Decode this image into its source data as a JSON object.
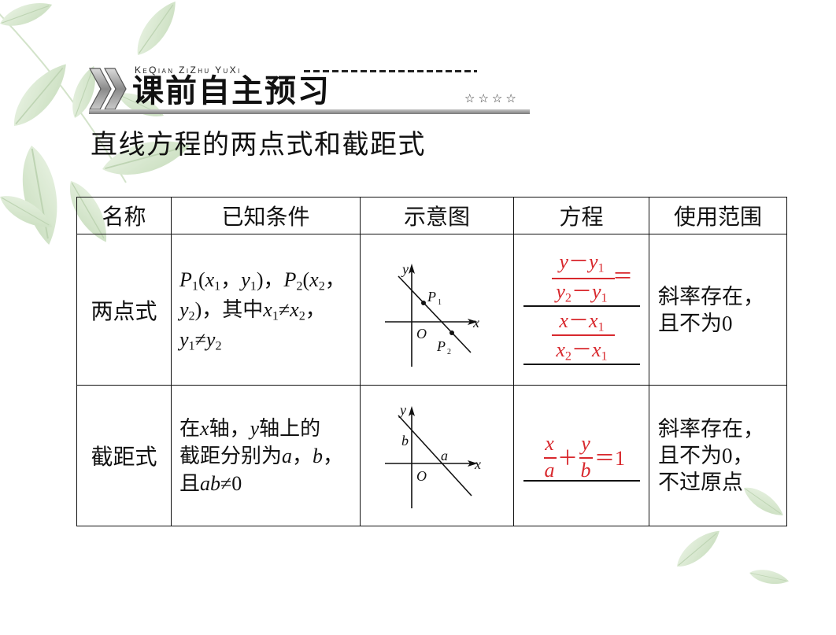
{
  "colors": {
    "answer_red": "#d8282d"
  },
  "header": {
    "pinyin": "KeQian ZiZhu YuXi",
    "title": "课前自主预习",
    "stars": "☆☆☆☆"
  },
  "subtitle": "直线方程的两点式和截距式",
  "table": {
    "headers": [
      "名称",
      "已知条件",
      "示意图",
      "方程",
      "使用范围"
    ],
    "rows": [
      {
        "name": "两点式",
        "conditions": [
          [
            {
              "i": "P"
            },
            {
              "sub": "1"
            },
            {
              "t": "("
            },
            {
              "i": "x"
            },
            {
              "sub": "1"
            },
            {
              "t": "，"
            },
            {
              "i": "y"
            },
            {
              "sub": "1"
            },
            {
              "t": ")，"
            },
            {
              "i": "P"
            },
            {
              "sub": "2"
            },
            {
              "t": "("
            },
            {
              "i": "x"
            },
            {
              "sub": "2"
            },
            {
              "t": "，"
            }
          ],
          [
            {
              "i": "y"
            },
            {
              "sub": "2"
            },
            {
              "t": ")，其中"
            },
            {
              "i": "x"
            },
            {
              "sub": "1"
            },
            {
              "t": "≠"
            },
            {
              "i": "x"
            },
            {
              "sub": "2"
            },
            {
              "t": "，"
            }
          ],
          [
            {
              "i": "y"
            },
            {
              "sub": "1"
            },
            {
              "t": "≠"
            },
            {
              "i": "y"
            },
            {
              "sub": "2"
            }
          ]
        ],
        "diagram": {
          "y_label": "y",
          "x_label": "x",
          "origin": "O",
          "p1": "P",
          "p1_sub": "1",
          "p2": "P",
          "p2_sub": "2"
        },
        "equation": {
          "left_num": [
            {
              "i": "y"
            },
            {
              "t": "－"
            },
            {
              "i": "y"
            },
            {
              "sub": "1"
            }
          ],
          "left_den": [
            {
              "i": "y"
            },
            {
              "sub": "2"
            },
            {
              "t": "－"
            },
            {
              "i": "y"
            },
            {
              "sub": "1"
            }
          ],
          "equals": "＝",
          "right_num": [
            {
              "i": "x"
            },
            {
              "t": "－"
            },
            {
              "i": "x"
            },
            {
              "sub": "1"
            }
          ],
          "right_den": [
            {
              "i": "x"
            },
            {
              "sub": "2"
            },
            {
              "t": "－"
            },
            {
              "i": "x"
            },
            {
              "sub": "1"
            }
          ]
        },
        "usage": [
          "斜率存在，",
          "且不为0"
        ]
      },
      {
        "name": "截距式",
        "conditions": [
          [
            {
              "t": "在"
            },
            {
              "i": "x"
            },
            {
              "t": "轴，"
            },
            {
              "i": "y"
            },
            {
              "t": "轴上的"
            }
          ],
          [
            {
              "t": "截距分别为"
            },
            {
              "i": "a"
            },
            {
              "t": "，"
            },
            {
              "i": "b"
            },
            {
              "t": "，"
            }
          ],
          [
            {
              "t": "且"
            },
            {
              "i": "ab"
            },
            {
              "t": "≠0"
            }
          ]
        ],
        "diagram": {
          "y_label": "y",
          "x_label": "x",
          "origin": "O",
          "y_intercept": "b",
          "x_intercept": "a"
        },
        "equation": {
          "x_num": "x",
          "x_den": "a",
          "plus": "＋",
          "y_num": "y",
          "y_den": "b",
          "equals": "＝1"
        },
        "usage": [
          "斜率存在，",
          "且不为0，",
          "不过原点"
        ]
      }
    ]
  }
}
